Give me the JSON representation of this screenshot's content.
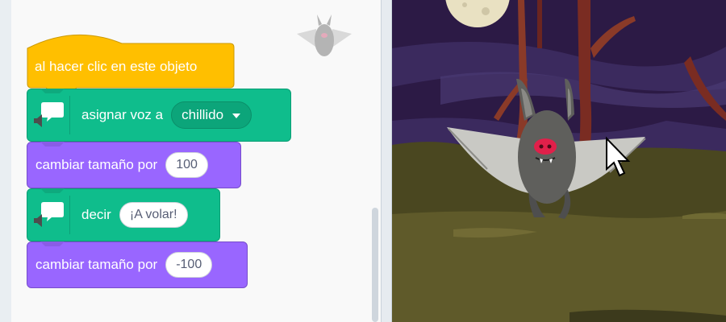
{
  "blocks": {
    "hat": {
      "label": "al hacer clic en este objeto"
    },
    "set_voice": {
      "label": "asignar voz a",
      "value": "chillido"
    },
    "change_size_1": {
      "label": "cambiar tamaño por",
      "value": "100"
    },
    "say": {
      "label": "decir",
      "value": "¡A volar!"
    },
    "change_size_2": {
      "label": "cambiar tamaño por",
      "value": "-100"
    }
  },
  "colors": {
    "events": "#ffbf00",
    "text2speech": "#0fbd8c",
    "looks": "#9966ff"
  },
  "icons": [
    "speech-bubble-speaker-icon",
    "dropdown-arrow-icon",
    "bat-sprite-icon",
    "mouse-cursor-icon"
  ]
}
